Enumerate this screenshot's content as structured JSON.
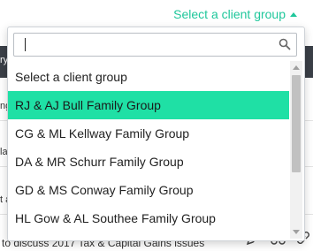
{
  "header": {
    "trigger_label": "Select a client group"
  },
  "background": {
    "nav_fragment": "ry",
    "row_fragments": [
      "ng",
      "la",
      "t a"
    ],
    "task_text": "to discuss 2017 Tax & Capital Gains issues"
  },
  "dropdown": {
    "search_value": "",
    "items": [
      {
        "label": "Select a client group",
        "active": false
      },
      {
        "label": "RJ & AJ Bull Family Group",
        "active": true
      },
      {
        "label": "CG & ML Kellway Family Group",
        "active": false
      },
      {
        "label": "DA & MR Schurr Family Group",
        "active": false
      },
      {
        "label": "GD & MS Conway Family Group",
        "active": false
      },
      {
        "label": "HL Gow & AL Southee Family Group",
        "active": false
      }
    ]
  },
  "colors": {
    "accent": "#1fc79b",
    "highlight": "#1fe0a5",
    "nav_bar": "#3a3f47"
  }
}
